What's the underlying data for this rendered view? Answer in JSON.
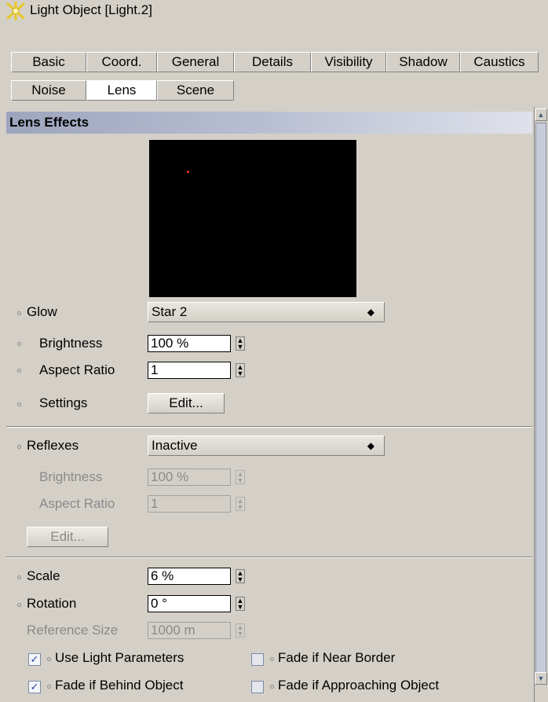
{
  "window": {
    "title": "Light Object [Light.2]",
    "icon": "light-object-icon"
  },
  "tabs": {
    "row1": [
      "Basic",
      "Coord.",
      "General",
      "Details",
      "Visibility",
      "Shadow",
      "Caustics"
    ],
    "row2": [
      "Noise",
      "Lens",
      "Scene"
    ],
    "active": "Lens"
  },
  "section": {
    "title": "Lens Effects"
  },
  "glow": {
    "label": "Glow",
    "value": "Star 2",
    "brightness_label": "Brightness",
    "brightness_value": "100 %",
    "aspect_label": "Aspect Ratio",
    "aspect_value": "1",
    "settings_label": "Settings",
    "edit_label": "Edit..."
  },
  "reflexes": {
    "label": "Reflexes",
    "value": "Inactive",
    "brightness_label": "Brightness",
    "brightness_value": "100 %",
    "aspect_label": "Aspect Ratio",
    "aspect_value": "1",
    "edit_label": "Edit..."
  },
  "general": {
    "scale_label": "Scale",
    "scale_value": "6 %",
    "rotation_label": "Rotation",
    "rotation_value": "0 °",
    "refsize_label": "Reference Size",
    "refsize_value": "1000 m"
  },
  "checkboxes": [
    {
      "label": "Use Light Parameters",
      "checked": true
    },
    {
      "label": "Fade if Near Border",
      "checked": false
    },
    {
      "label": "Fade if Behind Object",
      "checked": true
    },
    {
      "label": "Fade if Approaching Object",
      "checked": false
    }
  ],
  "icons": {
    "spinner": "spinner-arrows-icon",
    "dropdown": "dropdown-arrows-icon",
    "checkmark": "checkmark-icon"
  }
}
